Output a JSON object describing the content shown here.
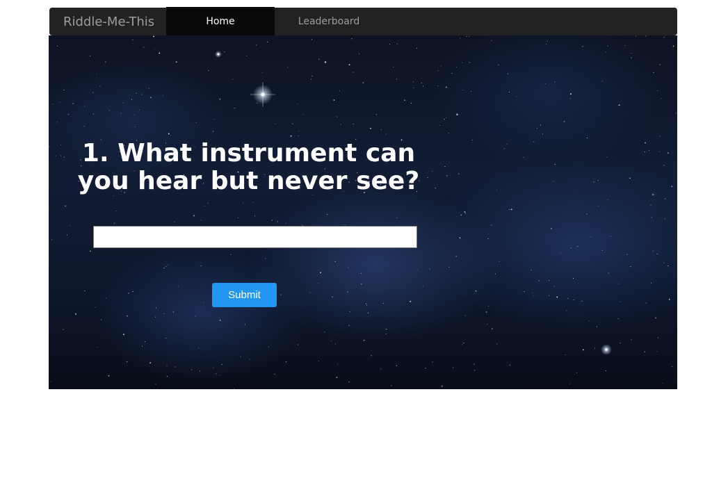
{
  "navbar": {
    "brand": "Riddle-Me-This",
    "links": [
      {
        "label": "Home",
        "active": true
      },
      {
        "label": "Leaderboard",
        "active": false
      }
    ]
  },
  "riddle": {
    "question": "1. What instrument can you hear but never see?",
    "answer_value": "",
    "answer_placeholder": "",
    "submit_label": "Submit"
  },
  "colors": {
    "navbar_bg": "#222222",
    "active_tab_bg": "#080808",
    "submit_button": "#2196f3",
    "hero_bg": "#0f1830"
  }
}
